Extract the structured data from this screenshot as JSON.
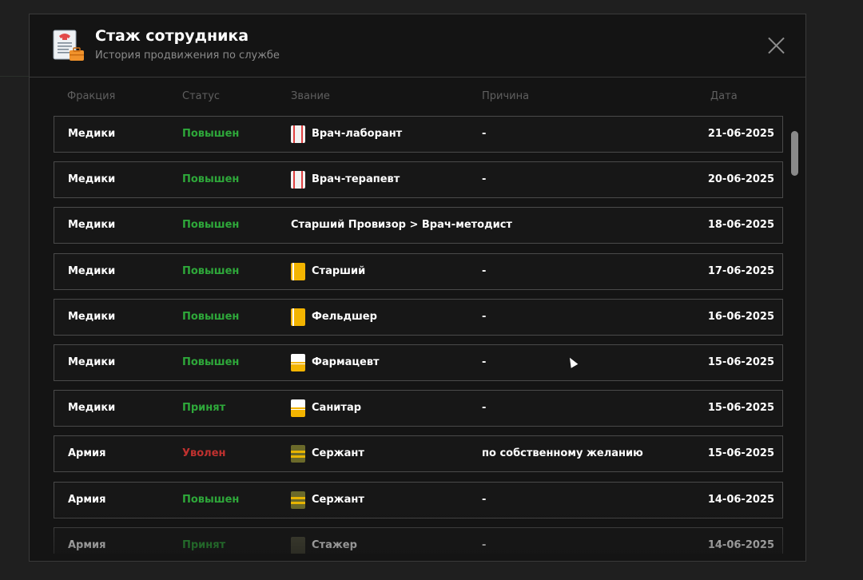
{
  "header": {
    "title": "Стаж сотрудника",
    "subtitle": "История продвижения по службе"
  },
  "columns": {
    "faction": "Фракция",
    "status": "Статус",
    "rank": "Звание",
    "reason": "Причина",
    "date": "Дата"
  },
  "rows": [
    {
      "faction": "Медики",
      "status": "Повышен",
      "status_color": "#2ea83a",
      "rank": "Врач-лаборант",
      "rank_icon": "white-red-stripe-icon",
      "reason": "-",
      "date": "21-06-2025"
    },
    {
      "faction": "Медики",
      "status": "Повышен",
      "status_color": "#2ea83a",
      "rank": "Врач-терапевт",
      "rank_icon": "white-red-stripe-icon",
      "reason": "-",
      "date": "20-06-2025"
    },
    {
      "faction": "Медики",
      "status": "Повышен",
      "status_color": "#2ea83a",
      "rank": "Старший Провизор > Врач-методист",
      "rank_icon": "",
      "reason": "",
      "date": "18-06-2025"
    },
    {
      "faction": "Медики",
      "status": "Повышен",
      "status_color": "#2ea83a",
      "rank": "Старший",
      "rank_icon": "yellow-epaulette-icon",
      "reason": "-",
      "date": "17-06-2025"
    },
    {
      "faction": "Медики",
      "status": "Повышен",
      "status_color": "#2ea83a",
      "rank": "Фельдшер",
      "rank_icon": "yellow-epaulette-icon",
      "reason": "-",
      "date": "16-06-2025"
    },
    {
      "faction": "Медики",
      "status": "Повышен",
      "status_color": "#2ea83a",
      "rank": "Фармацевт",
      "rank_icon": "half-yellow-epaulette-icon",
      "reason": "-",
      "date": "15-06-2025"
    },
    {
      "faction": "Медики",
      "status": "Принят",
      "status_color": "#2ea83a",
      "rank": "Санитар",
      "rank_icon": "half-yellow-epaulette-icon",
      "reason": "-",
      "date": "15-06-2025"
    },
    {
      "faction": "Армия",
      "status": "Уволен",
      "status_color": "#c0312f",
      "rank": "Сержант",
      "rank_icon": "olive-epaulette-icon",
      "reason": "по собственному желанию",
      "date": "15-06-2025"
    },
    {
      "faction": "Армия",
      "status": "Повышен",
      "status_color": "#2ea83a",
      "rank": "Сержант",
      "rank_icon": "olive-epaulette-icon",
      "reason": "-",
      "date": "14-06-2025"
    },
    {
      "faction": "Армия",
      "status": "Принят",
      "status_color": "#2ea83a",
      "rank": "Стажер",
      "rank_icon": "dark-epaulette-icon",
      "reason": "-",
      "date": "14-06-2025"
    }
  ]
}
